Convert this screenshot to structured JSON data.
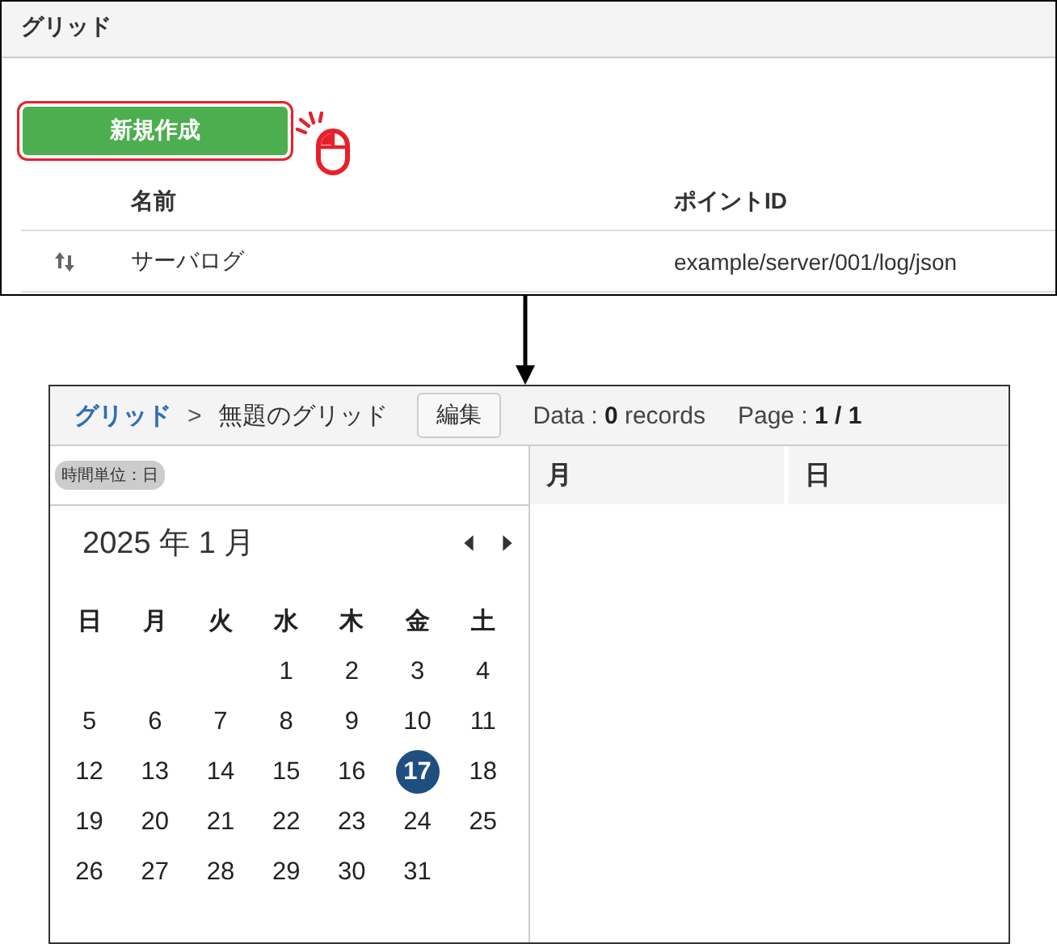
{
  "list_panel": {
    "title": "グリッド",
    "new_button": {
      "label": "新規作成",
      "highlighted": true
    },
    "table": {
      "columns": [
        "名前",
        "ポイントID"
      ],
      "rows": [
        {
          "name": "サーバログ",
          "point_id": "example/server/001/log/json"
        }
      ]
    }
  },
  "grid_view": {
    "breadcrumb": [
      {
        "label": "グリッド",
        "kind": "link"
      },
      {
        "label": "無題のグリッド",
        "kind": "current"
      }
    ],
    "breadcrumb_separator": ">",
    "edit_button": "編集",
    "data_info": "Data : **0** records",
    "page_info": "Page : **1 / 1**",
    "time_unit_badge": "時間単位：日",
    "calendar": {
      "title": "2025 年 1 月",
      "weekdays": [
        "日",
        "月",
        "火",
        "水",
        "木",
        "金",
        "土"
      ],
      "weeks": [
        {
          "kind": "leading",
          "days": [
            {
              "day": "1",
              "selected": false
            },
            {
              "day": "2",
              "selected": false
            },
            {
              "day": "3",
              "selected": false
            },
            {
              "day": "4",
              "selected": false
            }
          ]
        },
        {
          "kind": "full",
          "days": [
            {
              "day": "5",
              "selected": false
            },
            {
              "day": "6",
              "selected": false
            },
            {
              "day": "7",
              "selected": false
            },
            {
              "day": "8",
              "selected": false
            },
            {
              "day": "9",
              "selected": false
            },
            {
              "day": "10",
              "selected": false
            },
            {
              "day": "11",
              "selected": false
            }
          ]
        },
        {
          "kind": "full",
          "days": [
            {
              "day": "12",
              "selected": false
            },
            {
              "day": "13",
              "selected": false
            },
            {
              "day": "14",
              "selected": false
            },
            {
              "day": "15",
              "selected": false
            },
            {
              "day": "16",
              "selected": false
            },
            {
              "day": "17",
              "selected": true
            },
            {
              "day": "18",
              "selected": false
            }
          ]
        },
        {
          "kind": "full",
          "days": [
            {
              "day": "19",
              "selected": false
            },
            {
              "day": "20",
              "selected": false
            },
            {
              "day": "21",
              "selected": false
            },
            {
              "day": "22",
              "selected": false
            },
            {
              "day": "23",
              "selected": false
            },
            {
              "day": "24",
              "selected": false
            },
            {
              "day": "25",
              "selected": false
            }
          ]
        },
        {
          "kind": "trailing",
          "days": [
            {
              "day": "26",
              "selected": false
            },
            {
              "day": "27",
              "selected": false
            },
            {
              "day": "28",
              "selected": false
            },
            {
              "day": "29",
              "selected": false
            },
            {
              "day": "30",
              "selected": false
            },
            {
              "day": "31",
              "selected": false
            }
          ]
        }
      ]
    },
    "columns": [
      "月",
      "日"
    ]
  }
}
